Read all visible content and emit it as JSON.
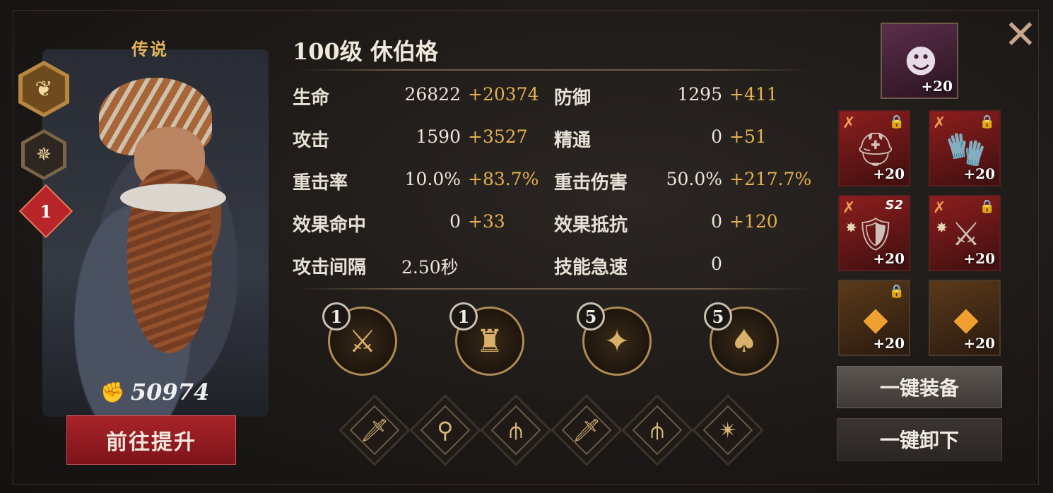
{
  "hero": {
    "rarity": "传说",
    "rank": "1",
    "power": "50974",
    "title": "100级  休伯格",
    "upgrade_label": "前往提升"
  },
  "stats": [
    {
      "label": "生命",
      "value": "26822",
      "bonus": "+20374"
    },
    {
      "label": "防御",
      "value": "1295",
      "bonus": "+411"
    },
    {
      "label": "攻击",
      "value": "1590",
      "bonus": "+3527"
    },
    {
      "label": "精通",
      "value": "0",
      "bonus": "+51"
    },
    {
      "label": "重击率",
      "value": "10.0%",
      "bonus": "+83.7%"
    },
    {
      "label": "重击伤害",
      "value": "50.0%",
      "bonus": "+217.7%"
    },
    {
      "label": "效果命中",
      "value": "0",
      "bonus": "+33"
    },
    {
      "label": "效果抵抗",
      "value": "0",
      "bonus": "+120"
    },
    {
      "label": "攻击间隔",
      "value": "2.50秒",
      "bonus": ""
    },
    {
      "label": "技能急速",
      "value": "0",
      "bonus": ""
    }
  ],
  "skills": [
    {
      "level": "1",
      "icon": "crossed-swords-icon"
    },
    {
      "level": "1",
      "icon": "knight-helmet-icon"
    },
    {
      "level": "5",
      "icon": "starburst-icon"
    },
    {
      "level": "5",
      "icon": "flame-shield-icon"
    }
  ],
  "runes": [
    {
      "icon": "sword-icon"
    },
    {
      "icon": "planted-sword-icon"
    },
    {
      "icon": "triple-blade-icon"
    },
    {
      "icon": "sword-icon"
    },
    {
      "icon": "triple-blade-icon"
    },
    {
      "icon": "compass-star-icon"
    }
  ],
  "equipment": {
    "mask": {
      "plus": "+20"
    },
    "slots": [
      {
        "plus": "+20",
        "locked": true
      },
      {
        "plus": "+20",
        "locked": true
      },
      {
        "plus": "+20",
        "locked": false,
        "set": "S2"
      },
      {
        "plus": "+20",
        "locked": true
      },
      {
        "plus": "+20",
        "locked": true
      },
      {
        "plus": "+20",
        "locked": false
      }
    ],
    "equip_all_label": "一键装备",
    "unequip_all_label": "一键卸下"
  },
  "colors": {
    "bonus": "#e4b24e",
    "primary_button": "#a8242a",
    "rarity": "#e2b45c"
  }
}
